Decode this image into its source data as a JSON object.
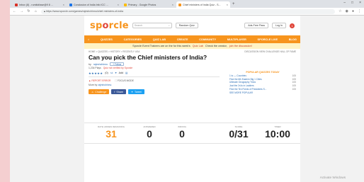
{
  "browser": {
    "tabs": [
      {
        "label": "Inbox (8) - rumitdrlase@9 8 ...",
        "icon_color": "#d93025",
        "active": false
      },
      {
        "label": "Conclusion of India Info ICC ...",
        "icon_color": "#1a73e8",
        "active": false
      },
      {
        "label": "Primary - Google Photos",
        "icon_color": "#fbbc04",
        "active": false
      },
      {
        "label": "Chief ministers of India Quiz - S...",
        "icon_color": "#f7941d",
        "active": true
      }
    ],
    "new_tab": "+",
    "url": "https://www.sporcle.com/games/rajeshchinnu/chief-ministers-of-india",
    "window_controls": [
      "–",
      "□",
      "×"
    ]
  },
  "site": {
    "logo_start": "sp",
    "logo_accent": "o",
    "logo_end": "rcle",
    "search_placeholder": "Search",
    "random_quiz": "Random Quiz",
    "ads_free": "Ads-Free Pass",
    "login": "Log In",
    "notifications": "1",
    "nav": [
      "QUIZZES",
      "CATEGORIES",
      "QUIZ LAB",
      "CREATE",
      "COMMUNITY",
      "MULTIPLAYER",
      "SPORCLE LIVE",
      "BLOG"
    ],
    "announcement": {
      "text": "Sporcle Event Trainers are on the for this week's",
      "link1": "Quiz Lab",
      "middle": "Check the creator,",
      "link2": "join the discussion!"
    }
  },
  "quiz": {
    "breadcrumb": "HOME > QUIZZES > HISTORY > RECENTLY USA",
    "breadcrumb_right": "DISCUSSION VIEW CHALLENGE HALL OF FAME",
    "title": "Can you pick the Chief ministers of India?",
    "by_label": "by",
    "author": "rajeshchinnu",
    "follow": "+ Follow",
    "plays": "1,234 Plays",
    "sporcle_tag": "Quiz not verified by Sporcle",
    "stars": "★★★★★",
    "rating_count": "(0)",
    "add": "Add",
    "report": "REPORT ERROR",
    "focus": "FOCUS MODE",
    "more_by_label": "More by",
    "more_by_author": "rajeshchinnu",
    "share_challenge": "Challenge",
    "share_fb": "Share",
    "share_tw": "Tweet"
  },
  "popular": {
    "title": "POPULAR QUIZZES TODAY",
    "items": [
      {
        "label": "1 to — Countries",
        "num": "100"
      },
      {
        "label": "Find the 6th Eastern Big 1 Cities",
        "num": "100"
      },
      {
        "label": "Ultimate Geography Trivia",
        "num": "100"
      },
      {
        "label": "Just the 2x1s in Ladders",
        "num": "100"
      },
      {
        "label": "Find the Ten Points of Presidents S...",
        "num": "100"
      }
    ],
    "more": "SEE MORE POPULAR"
  },
  "stats": [
    {
      "label": "Rate Hidden Remaining",
      "value": "31",
      "accent": true
    },
    {
      "label": "Answered",
      "value": "0",
      "accent": false
    },
    {
      "label": "Wrong",
      "value": "0",
      "accent": false
    },
    {
      "label": "Score",
      "value": "0/31",
      "accent": false
    },
    {
      "label": "Timer",
      "value": "10:00",
      "accent": false
    }
  ],
  "watermark": "Activate Windows",
  "colors": {
    "brand_orange": "#f7941d",
    "brand_red": "#e0463a",
    "link_blue": "#2a6db5"
  }
}
